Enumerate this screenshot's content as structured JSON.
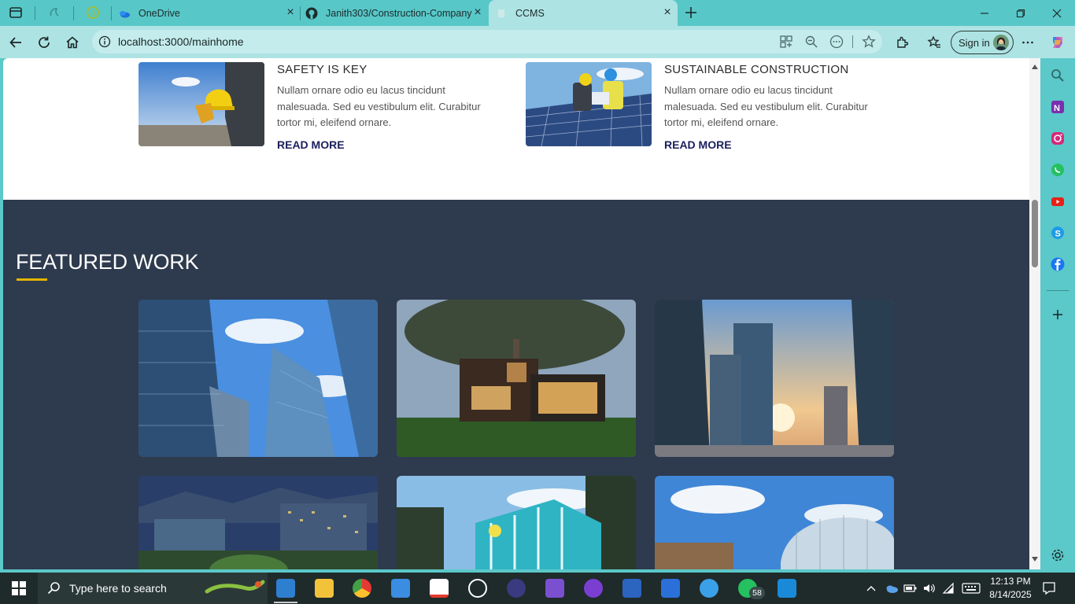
{
  "browser": {
    "tabs": [
      {
        "title": "OneDrive"
      },
      {
        "title": "Janith303/Construction-Company"
      },
      {
        "title": "CCMS"
      }
    ],
    "address": "localhost:3000/mainhome",
    "signin_label": "Sign in"
  },
  "page": {
    "posts": [
      {
        "title": "SAFETY IS KEY",
        "body": "Nullam ornare odio eu lacus tincidunt malesuada. Sed eu vestibulum elit. Curabitur tortor mi, eleifend ornare.",
        "more": "READ MORE"
      },
      {
        "title": "SUSTAINABLE CONSTRUCTION",
        "body": "Nullam ornare odio eu lacus tincidunt malesuada. Sed eu vestibulum elit. Curabitur tortor mi, eleifend ornare.",
        "more": "READ MORE"
      }
    ],
    "featured_title": "FEATURED WORK",
    "accent_color": "#e2b400",
    "featured_bg": "#2e3a4d"
  },
  "taskbar": {
    "search_placeholder": "Type here to search",
    "whatsapp_badge": "58",
    "time": "12:13 PM",
    "date": "8/14/2025"
  }
}
